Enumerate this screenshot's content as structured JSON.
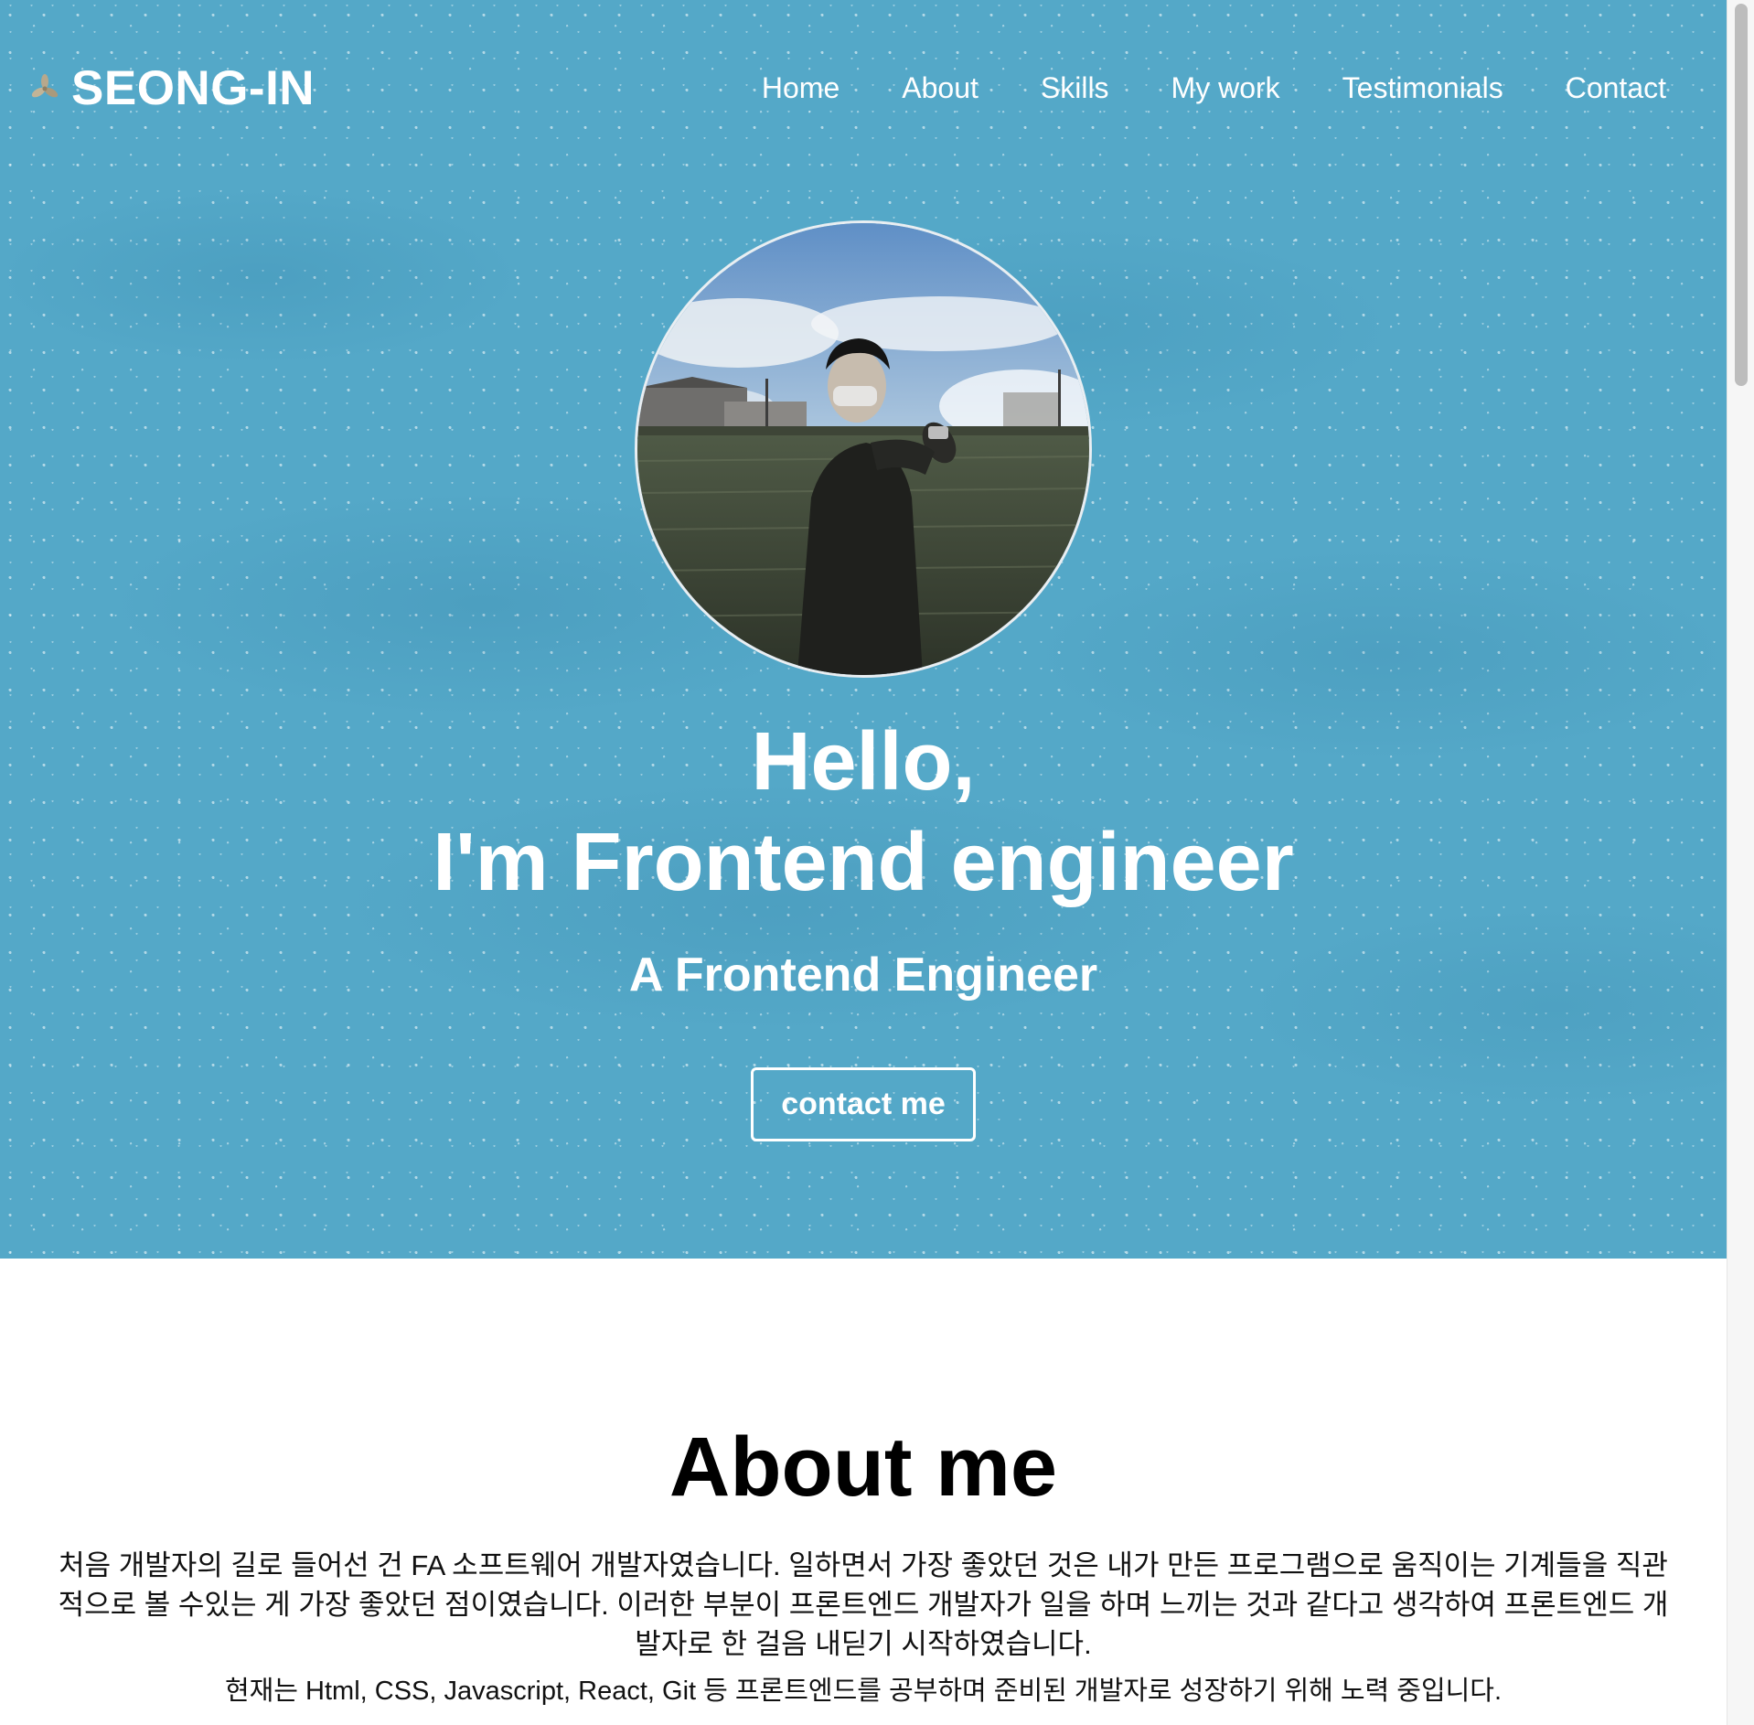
{
  "header": {
    "brand_title": "SEONG-IN",
    "brand_icon": "flower-logo-icon",
    "nav": [
      {
        "label": "Home"
      },
      {
        "label": "About"
      },
      {
        "label": "Skills"
      },
      {
        "label": "My work"
      },
      {
        "label": "Testimonials"
      },
      {
        "label": "Contact"
      }
    ]
  },
  "hero": {
    "title_line1": "Hello,",
    "title_line2": "I'm Frontend engineer",
    "subtitle": "A Frontend Engineer",
    "contact_button": "contact me",
    "background_color": "#54a8c8"
  },
  "about": {
    "title": "About me",
    "description": "처음 개발자의 길로 들어선 건 FA 소프트웨어 개발자였습니다. 일하면서 가장 좋았던 것은 내가 만든 프로그램으로 움직이는 기계들을 직관적으로 볼 수있는 게 가장 좋았던 점이였습니다. 이러한 부분이 프론트엔드 개발자가 일을 하며 느끼는 것과 같다고 생각하여 프론트엔드 개발자로 한 걸음 내딛기 시작하였습니다.",
    "description2": "현재는 Html, CSS, Javascript, React, Git 등 프론트엔드를 공부하며 준비된 개발자로 성장하기 위해 노력 중입니다."
  }
}
